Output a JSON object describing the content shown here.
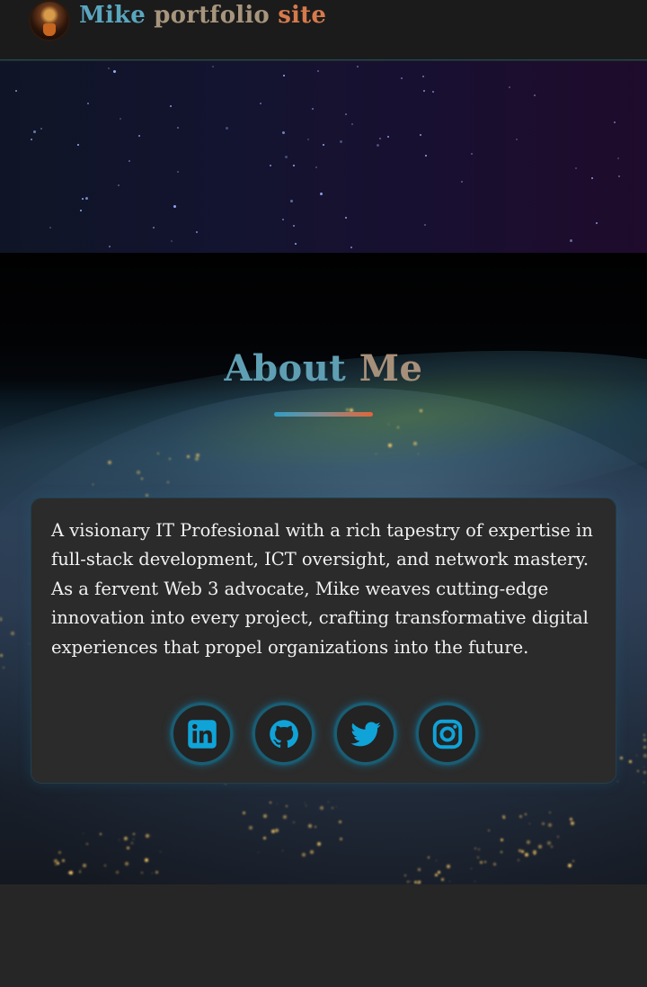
{
  "header": {
    "logo_word1": "Mike",
    "logo_word2": "portfolio",
    "logo_word3": "site",
    "avatar_icon": "avatar"
  },
  "about": {
    "title_word1": "About",
    "title_word2": "Me",
    "bio": "A visionary IT Profesional with a rich tapestry of expertise in full-stack development, ICT oversight, and network mastery. As a fervent Web 3 advocate, Mike weaves cutting-edge innovation into every project, crafting transformative digital experiences that propel organizations into the future."
  },
  "socials": [
    {
      "name": "LinkedIn",
      "icon": "linkedin-icon"
    },
    {
      "name": "GitHub",
      "icon": "github-icon"
    },
    {
      "name": "Twitter",
      "icon": "twitter-icon"
    },
    {
      "name": "Instagram",
      "icon": "instagram-icon"
    }
  ],
  "colors": {
    "accent_blue": "#0fa3d8",
    "title_blue": "#5aa6bf",
    "title_tan": "#a7957d",
    "title_orange": "#d67a4c",
    "card_bg": "#2b2b2b",
    "page_bg": "#262626"
  }
}
